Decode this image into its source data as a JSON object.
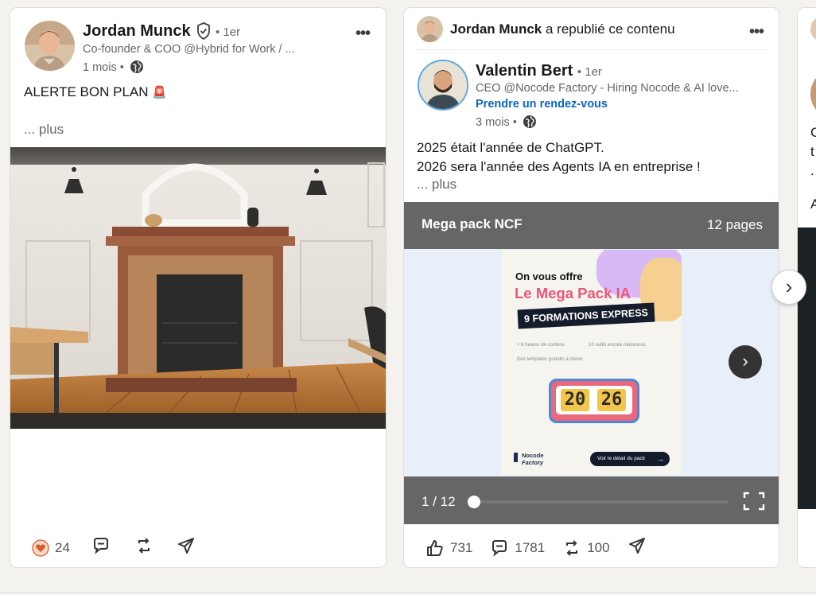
{
  "post1": {
    "author_name": "Jordan Munck",
    "degree": "• 1er",
    "headline": "Co-founder & COO @Hybrid for Work / ...",
    "time": "1 mois •",
    "text": "ALERTE BON PLAN",
    "text_emoji": "🚨",
    "more": "... plus",
    "reactions_count": "24"
  },
  "post2": {
    "reposter_name": "Jordan Munck",
    "reposted_text": "a republié ce contenu",
    "author_name": "Valentin Bert",
    "degree": "• 1er",
    "headline": "CEO @Nocode Factory - Hiring Nocode & AI love...",
    "cta_link": "Prendre un rendez-vous",
    "time": "3 mois •",
    "text_line1": "2025 était l'année de ChatGPT.",
    "text_line2": "2026 sera l'année des Agents IA en entreprise !",
    "more": "... plus",
    "doc_title": "Mega pack NCF",
    "doc_pages": "12 pages",
    "page_indicator": "1 / 12",
    "slide": {
      "offer": "On vous offre",
      "title": "Le Mega Pack IA",
      "banner": "9 FORMATIONS EXPRESS",
      "bullet1": "+ 6 heures de contenu",
      "bullet2": "10 outils encore méconnus",
      "bullet3": "Des templates gratuits à cloner",
      "clock_left": "20",
      "clock_right": "26",
      "logo_line1": "Nocode",
      "logo_line2": "Factory",
      "cta": "Voir le détail du pack"
    },
    "reactions_count": "731",
    "comments_count": "1781",
    "reposts_count": "100"
  },
  "post3_partial": {
    "line1": "C",
    "line2": "t",
    "line3": ".",
    "line4": "A"
  },
  "colors": {
    "link_blue": "#0a66c2",
    "doc_header_gray": "#666666",
    "heart_orange": "#d85b2b"
  }
}
